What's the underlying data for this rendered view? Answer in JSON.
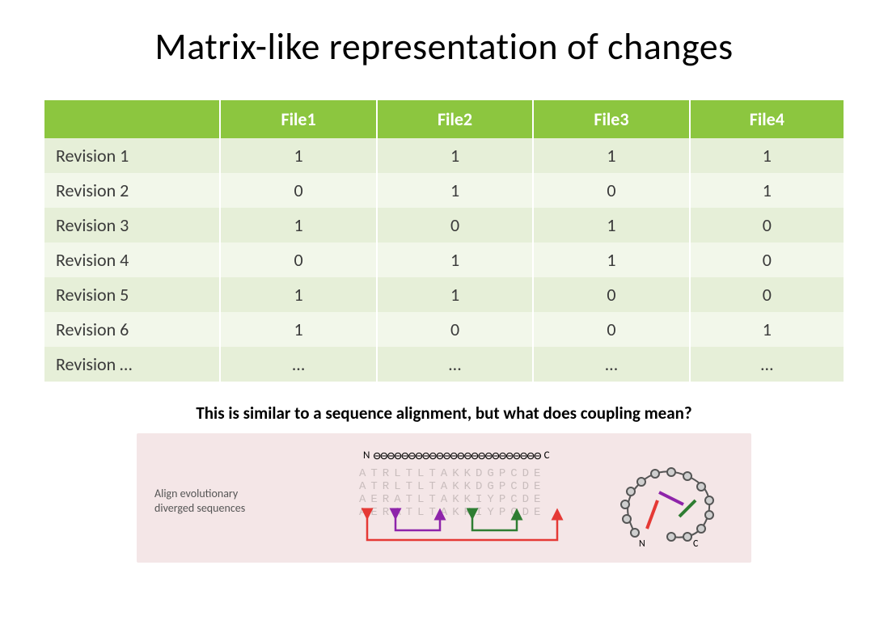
{
  "title": "Matrix-like representation of changes",
  "table": {
    "headers": [
      "",
      "File1",
      "File2",
      "File3",
      "File4"
    ],
    "rows": [
      {
        "label": "Revision 1",
        "cells": [
          "1",
          "1",
          "1",
          "1"
        ]
      },
      {
        "label": "Revision 2",
        "cells": [
          "0",
          "1",
          "0",
          "1"
        ]
      },
      {
        "label": "Revision 3",
        "cells": [
          "1",
          "0",
          "1",
          "0"
        ]
      },
      {
        "label": "Revision 4",
        "cells": [
          "0",
          "1",
          "1",
          "0"
        ]
      },
      {
        "label": "Revision 5",
        "cells": [
          "1",
          "1",
          "0",
          "0"
        ]
      },
      {
        "label": "Revision 6",
        "cells": [
          "1",
          "0",
          "0",
          "1"
        ]
      },
      {
        "label": "Revision …",
        "cells": [
          "…",
          "…",
          "…",
          "…"
        ]
      }
    ]
  },
  "caption": "This is similar to a sequence alignment, but what does coupling mean?",
  "diagram": {
    "align_label_line1": "Align evolutionary",
    "align_label_line2": "diverged sequences",
    "chain_left": "N",
    "chain_beads": "⊖⊖⊖⊖⊖⊖⊖⊖⊖⊖⊖⊖⊖⊖⊖⊖⊖⊖⊖⊖⊖⊖⊖⊖",
    "chain_right": "C",
    "seq_line1": "ATRLTLTAKKDGPCDE",
    "seq_line2": "ATRLTLTAKKDGPCDE",
    "seq_line3": "AERATLTAKKIYPCDE",
    "seq_line4": "AERATLTAKKIYPCDE",
    "mol_N": "N",
    "mol_C": "C"
  }
}
